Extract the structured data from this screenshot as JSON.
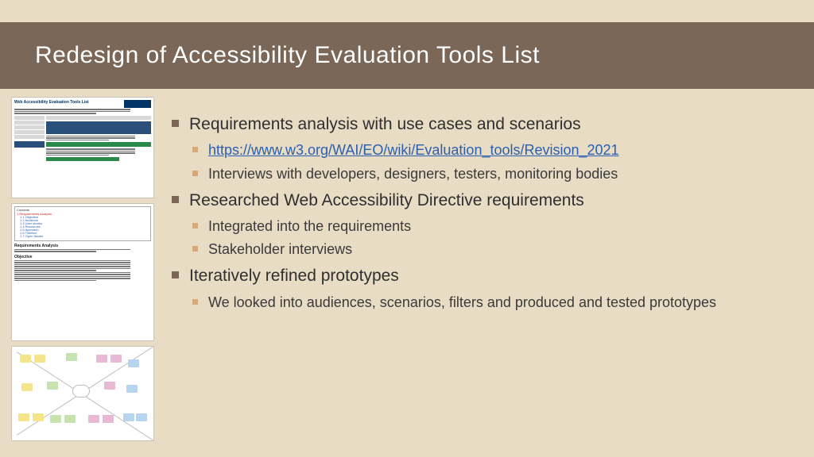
{
  "title": "Redesign of Accessibility Evaluation Tools List",
  "bullets": [
    {
      "label": "Requirements analysis with use cases and scenarios",
      "sub": [
        {
          "type": "link",
          "text": "https://www.w3.org/WAI/EO/wiki/Evaluation_tools/Revision_2021",
          "href": "https://www.w3.org/WAI/EO/wiki/Evaluation_tools/Revision_2021"
        },
        {
          "type": "text",
          "text": "Interviews with developers, designers, testers, monitoring bodies"
        }
      ]
    },
    {
      "label": "Researched Web Accessibility Directive requirements",
      "sub": [
        {
          "type": "text",
          "text": "Integrated into the requirements"
        },
        {
          "type": "text",
          "text": "Stakeholder interviews"
        }
      ]
    },
    {
      "label": "Iteratively refined prototypes",
      "sub": [
        {
          "type": "text",
          "text": "We looked into audiences, scenarios, filters and produced and tested prototypes"
        }
      ]
    }
  ],
  "thumbnails": {
    "t1_title": "Web Accessibility Evaluation Tools List",
    "t2_contents_label": "Contents",
    "t2_toc": [
      "1 Requirements Analysis",
      "1.1 Objective",
      "1.2 Audience",
      "1.3 User stories",
      "1.4 Resources",
      "1.5 Approach",
      "1.6 Timeline",
      "1.7 Open Issues"
    ],
    "t2_h1": "Requirements Analysis",
    "t2_h2": "Objective"
  }
}
